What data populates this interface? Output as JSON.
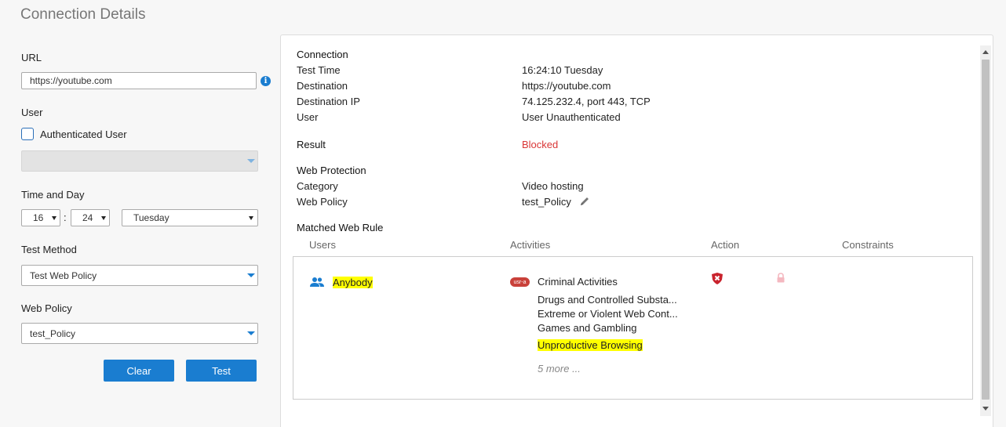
{
  "page": {
    "title": "Connection Details"
  },
  "form": {
    "url_label": "URL",
    "url_value": "https://youtube.com",
    "user_label": "User",
    "auth_user_label": "Authenticated User",
    "time_label": "Time and Day",
    "hour": "16",
    "colon": ":",
    "minute": "24",
    "day": "Tuesday",
    "method_label": "Test Method",
    "method_value": "Test Web Policy",
    "policy_label": "Web Policy",
    "policy_value": "test_Policy",
    "clear_label": "Clear",
    "test_label": "Test"
  },
  "result": {
    "connection_heading": "Connection",
    "rows": [
      {
        "key": "Test Time",
        "value": "16:24:10 Tuesday"
      },
      {
        "key": "Destination",
        "value": "https://youtube.com"
      },
      {
        "key": "Destination IP",
        "value": "74.125.232.4, port 443, TCP"
      },
      {
        "key": "User",
        "value": "User Unauthenticated"
      }
    ],
    "result_label": "Result",
    "result_value": "Blocked",
    "web_protection_heading": "Web Protection",
    "category_key": "Category",
    "category_value": "Video hosting",
    "policy_key": "Web Policy",
    "policy_value": "test_Policy",
    "matched_rule_heading": "Matched Web Rule",
    "columns": [
      "Users",
      "Activities",
      "Action",
      "Constraints"
    ],
    "rule": {
      "user": "Anybody",
      "badge": "usr-a",
      "activities": [
        "Criminal Activities",
        "Drugs and Controlled Substa...",
        "Extreme or Violent Web Cont...",
        "Games and Gambling",
        "Unproductive Browsing"
      ],
      "more": "5 more ..."
    }
  },
  "colors": {
    "accent": "#1a7dd0",
    "blocked": "#d93636",
    "highlight": "#ffff00"
  },
  "icons": [
    "info-icon",
    "users-icon",
    "pencil-icon",
    "block-shield-icon",
    "lock-icon"
  ]
}
